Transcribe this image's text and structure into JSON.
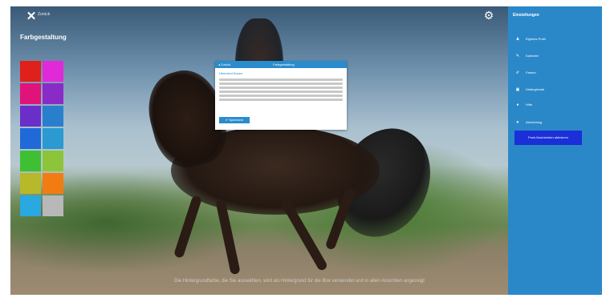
{
  "topbar": {
    "close_icon": "close-icon",
    "close_label": "Zurück",
    "settings_icon": "gear-icon"
  },
  "left_panel": {
    "title": "Farbgestaltung",
    "swatches": [
      "#e0201b",
      "#e02ad8",
      "#e0137a",
      "#8a2bc8",
      "#6a2fc8",
      "#2a7fcc",
      "#1f6ad8",
      "#2a9ad0",
      "#3fbf33",
      "#8ec43a",
      "#b7b82a",
      "#f27c12",
      "#2aa8e0",
      "#b8b8b8"
    ]
  },
  "dialog": {
    "back_label": "Zurück",
    "title": "Farbgestaltung",
    "heading": "Übersicht Boxen",
    "button_label": "Speichern",
    "accent": "#2a8ccc"
  },
  "caption": {
    "text": "Die Hintergrundfarbe, die Sie auswählen, wird als Hintergrund für die Box verwendet und in allen Ansichten angezeigt"
  },
  "sidebar": {
    "title": "Einstellungen",
    "items": [
      {
        "label": "Eigenes Profil",
        "icon": "user-icon"
      },
      {
        "label": "Kalender",
        "icon": "pencil-icon"
      },
      {
        "label": "Farben",
        "icon": "brush-icon"
      },
      {
        "label": "Hintergründe",
        "icon": "image-icon"
      },
      {
        "label": "Hilfe",
        "icon": "help-icon"
      },
      {
        "label": "Abmeldung",
        "icon": "heart-icon"
      }
    ],
    "button_label": "Push-Nachrichten aktivieren",
    "color": "#2b88c8",
    "button_color": "#1a2fd8"
  }
}
